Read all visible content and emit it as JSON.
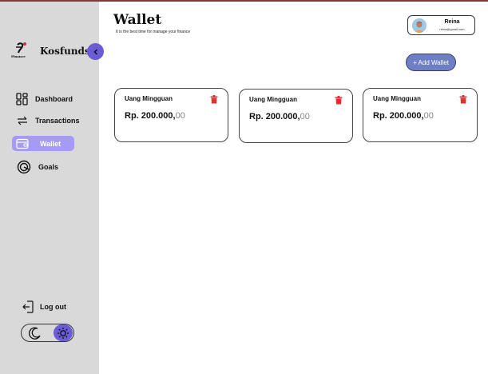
{
  "brand": {
    "name": "Kosfunds",
    "logo_text": "Finance"
  },
  "sidebar": {
    "items": [
      {
        "label": "Dashboard",
        "icon": "dashboard-icon"
      },
      {
        "label": "Transactions",
        "icon": "transactions-icon"
      },
      {
        "label": "Wallet",
        "icon": "wallet-icon",
        "active": true
      },
      {
        "label": "Goals",
        "icon": "goals-icon"
      }
    ],
    "logout_label": "Log out"
  },
  "header": {
    "title": "Wallet",
    "subtitle": "It is the best time for manage your finance"
  },
  "profile": {
    "name": "Reina",
    "email": "reina@gmail.com"
  },
  "actions": {
    "add_wallet_label": "+ Add Wallet"
  },
  "wallets": [
    {
      "name": "Uang Mingguan",
      "amount_main": "Rp. 200.000,",
      "amount_cents": "00"
    },
    {
      "name": "Uang Mingguan",
      "amount_main": "Rp. 200.000,",
      "amount_cents": "00"
    },
    {
      "name": "Uang Mingguan",
      "amount_main": "Rp. 200.000,",
      "amount_cents": "00"
    }
  ],
  "colors": {
    "sidebar_bg": "#d9d9d9",
    "accent_purple": "#6a5bd6",
    "active_nav": "#a69bf3",
    "add_button": "#6f7fc6",
    "trash_red": "#e0302f"
  }
}
